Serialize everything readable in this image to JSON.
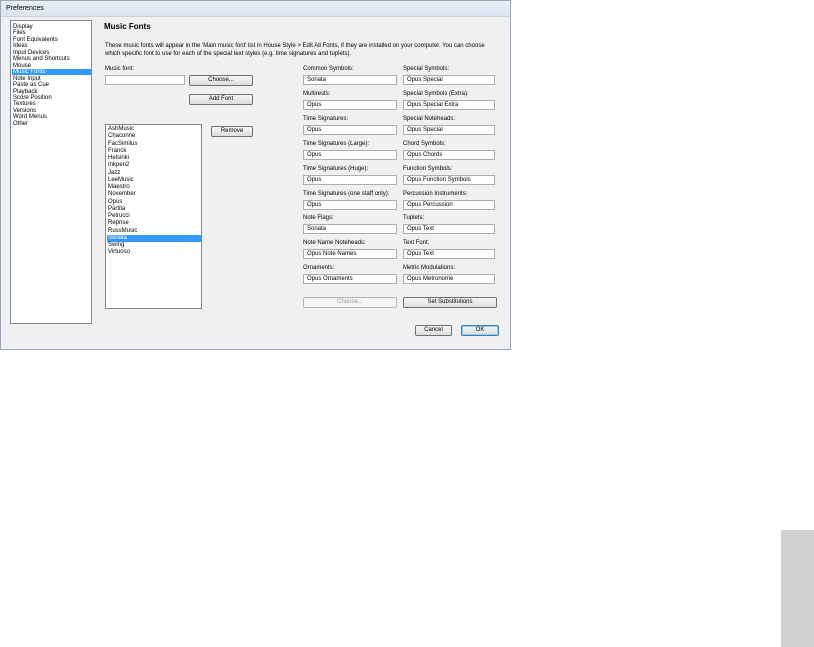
{
  "window": {
    "title": "Preferences"
  },
  "sidebar": {
    "items": [
      {
        "label": "Display"
      },
      {
        "label": "Files"
      },
      {
        "label": "Font Equivalents"
      },
      {
        "label": "Ideas"
      },
      {
        "label": "Input Devices"
      },
      {
        "label": "Menus and Shortcuts"
      },
      {
        "label": "Mouse"
      },
      {
        "label": "Music Fonts",
        "selected": true
      },
      {
        "label": "Note Input"
      },
      {
        "label": "Paste as Cue"
      },
      {
        "label": "Playback"
      },
      {
        "label": "Score Position"
      },
      {
        "label": "Textures"
      },
      {
        "label": "Versions"
      },
      {
        "label": "Word Menus"
      },
      {
        "label": "Other"
      }
    ]
  },
  "main": {
    "heading": "Music Fonts",
    "description": "These music fonts will appear in the 'Main music font' list in House Style > Edit All Fonts, if they are installed on your computer.  You can choose which specific font to use for each of the special text styles (e.g. time signatures and tuplets).",
    "music_font_label": "Music font:",
    "music_font_value": "",
    "choose_label": "Choose...",
    "add_font_label": "Add Font",
    "remove_label": "Remove",
    "font_list": [
      {
        "label": "AshMusic"
      },
      {
        "label": "Chaconne"
      },
      {
        "label": "FacSimilus"
      },
      {
        "label": "Franck"
      },
      {
        "label": "Helsinki"
      },
      {
        "label": "Inkpen2"
      },
      {
        "label": "Jazz"
      },
      {
        "label": "LeeMusic"
      },
      {
        "label": "Maestro"
      },
      {
        "label": "November"
      },
      {
        "label": "Opus"
      },
      {
        "label": "Partita"
      },
      {
        "label": "Petrucci"
      },
      {
        "label": "Reprise"
      },
      {
        "label": "RussMusic"
      },
      {
        "label": "Sonata",
        "selected": true
      },
      {
        "label": "Swing"
      },
      {
        "label": "Virtuoso"
      }
    ],
    "left_fields": [
      {
        "label": "Common Symbols:",
        "value": "Sonata"
      },
      {
        "label": "Multirests:",
        "value": "Opus"
      },
      {
        "label": "Time Signatures:",
        "value": "Opus"
      },
      {
        "label": "Time Signatures (Large):",
        "value": "Opus"
      },
      {
        "label": "Time Signatures (Huge):",
        "value": "Opus"
      },
      {
        "label": "Time Signatures (one staff only):",
        "value": "Opus"
      },
      {
        "label": "Note Flags:",
        "value": "Sonata"
      },
      {
        "label": "Note Name Noteheads:",
        "value": "Opus Note Names"
      },
      {
        "label": "Ornaments:",
        "value": "Opus Ornaments"
      }
    ],
    "right_fields": [
      {
        "label": "Special Symbols:",
        "value": "Opus Special"
      },
      {
        "label": "Special Symbols (Extra):",
        "value": "Opus Special Extra"
      },
      {
        "label": "Special Noteheads:",
        "value": "Opus Special"
      },
      {
        "label": "Chord Symbols:",
        "value": "Opus Chords"
      },
      {
        "label": "Function Symbols:",
        "value": "Opus Function Symbols"
      },
      {
        "label": "Percussion Instruments:",
        "value": "Opus Percussion"
      },
      {
        "label": "Tuplets:",
        "value": "Opus Text"
      },
      {
        "label": "Text Font:",
        "value": "Opus Text"
      },
      {
        "label": "Metric Modulations:",
        "value": "Opus Metronome"
      }
    ],
    "choose_disabled_label": "Choose...",
    "set_substitutions_label": "Set Substitutions"
  },
  "footer": {
    "cancel_label": "Cancel",
    "ok_label": "OK"
  }
}
